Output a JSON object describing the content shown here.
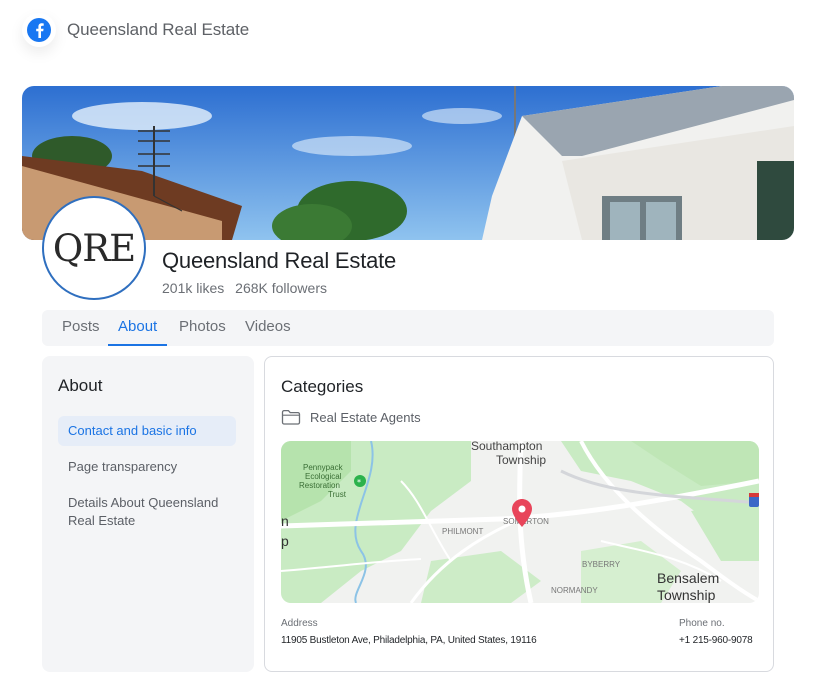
{
  "header": {
    "app_icon": "facebook-icon",
    "title": "Queensland Real Estate"
  },
  "profile": {
    "avatar_text": "QRE",
    "name": "Queensland Real Estate",
    "likes": "201k likes",
    "followers": "268K followers"
  },
  "tabs": [
    {
      "label": "Posts",
      "active": false
    },
    {
      "label": "About",
      "active": true
    },
    {
      "label": "Photos",
      "active": false
    },
    {
      "label": "Videos",
      "active": false
    }
  ],
  "about": {
    "title": "About",
    "items": [
      {
        "label": "Contact and basic info",
        "active": true
      },
      {
        "label": "Page transparency",
        "active": false
      },
      {
        "label": "Details About Queensland Real Estate",
        "active": false
      }
    ]
  },
  "categories": {
    "title": "Categories",
    "category_icon": "folder-icon",
    "category": "Real Estate Agents"
  },
  "map": {
    "labels": {
      "southampton": "Southampton",
      "township1": "Township",
      "pennypack1": "Pennypack",
      "pennypack2": "Ecological",
      "pennypack3": "Restoration",
      "pennypack4": "Trust",
      "philmont": "PHILMONT",
      "somerton": "SOMERTON",
      "byberry": "BYBERRY",
      "normandy": "NORMANDY",
      "bensalem": "Bensalem",
      "township2": "Township",
      "edge_n": "n",
      "edge_p": "p"
    },
    "marker_icon": "map-pin-icon"
  },
  "contact": {
    "address_label": "Address",
    "address": "11905 Bustleton Ave, Philadelphia, PA, United States, 19116",
    "phone_label": "Phone no.",
    "phone": "+1 215-960-9078"
  },
  "colors": {
    "accent": "#1b74e4",
    "facebook": "#1877f2",
    "avatar_ring": "#2f6fbf",
    "map_marker": "#e8455a"
  }
}
